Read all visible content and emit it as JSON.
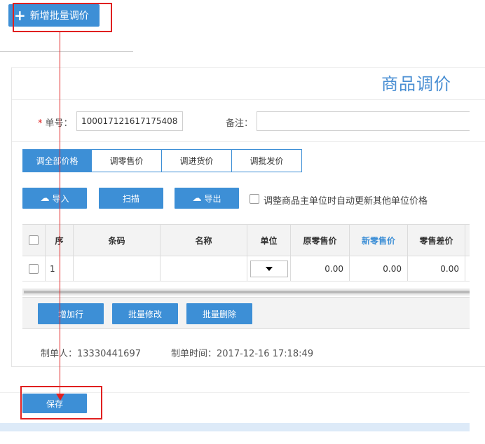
{
  "toolbar": {
    "add_batch_label": "新增批量调价"
  },
  "header": {
    "title": "商品调价"
  },
  "form": {
    "order_no_label": "单号：",
    "order_no_value": "100017121617175408",
    "remark_label": "备注："
  },
  "tabs": [
    {
      "label": "调全部价格",
      "active": true
    },
    {
      "label": "调零售价",
      "active": false
    },
    {
      "label": "调进货价",
      "active": false
    },
    {
      "label": "调批发价",
      "active": false
    }
  ],
  "actions": {
    "import_label": "导入",
    "scan_label": "扫描",
    "export_label": "导出",
    "auto_update_label": "调整商品主单位时自动更新其他单位价格"
  },
  "table": {
    "columns": [
      "序",
      "条码",
      "名称",
      "单位",
      "原零售价",
      "新零售价",
      "零售差价"
    ],
    "rows": [
      {
        "index": "1",
        "barcode": "",
        "name": "",
        "unit": "",
        "old_retail": "0.00",
        "new_retail": "0.00",
        "retail_diff": "0.00"
      }
    ]
  },
  "row_actions": {
    "add_row_label": "增加行",
    "batch_edit_label": "批量修改",
    "batch_delete_label": "批量删除"
  },
  "footer": {
    "creator_label": "制单人：",
    "creator_value": "13330441697",
    "created_time_label": "制单时间：",
    "created_time_value": "2017-12-16 17:18:49"
  },
  "save": {
    "label": "保存"
  },
  "colors": {
    "primary": "#3d8fd6",
    "annotation": "#e02020"
  }
}
